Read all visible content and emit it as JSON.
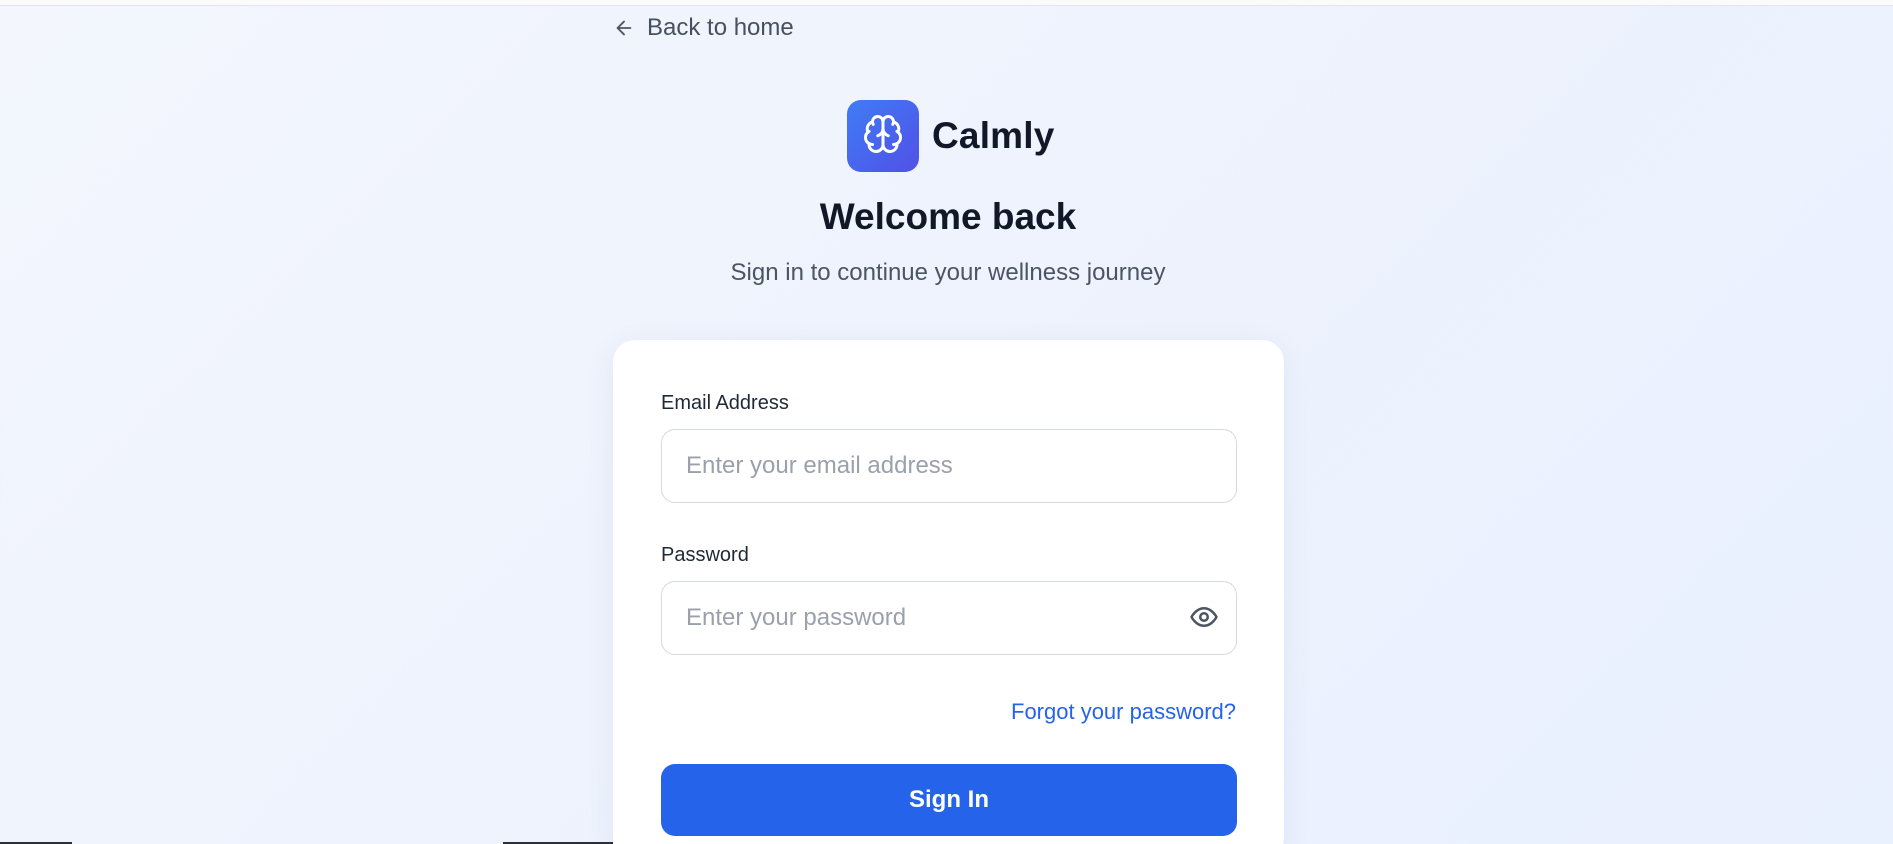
{
  "nav": {
    "back_label": "Back to home"
  },
  "brand": {
    "name": "Calmly",
    "logo_icon": "brain-icon",
    "accent_gradient": [
      "#3f7cf6",
      "#5150e6"
    ]
  },
  "intro": {
    "title": "Welcome back",
    "subtitle": "Sign in to continue your wellness journey"
  },
  "form": {
    "email": {
      "label": "Email Address",
      "placeholder": "Enter your email address",
      "value": ""
    },
    "password": {
      "label": "Password",
      "placeholder": "Enter your password",
      "value": "",
      "toggle_icon": "eye-icon"
    },
    "forgot_label": "Forgot your password?",
    "submit_label": "Sign In"
  },
  "colors": {
    "primary": "#2563eb",
    "text_dark": "#111827",
    "text_muted": "#4b5563"
  }
}
